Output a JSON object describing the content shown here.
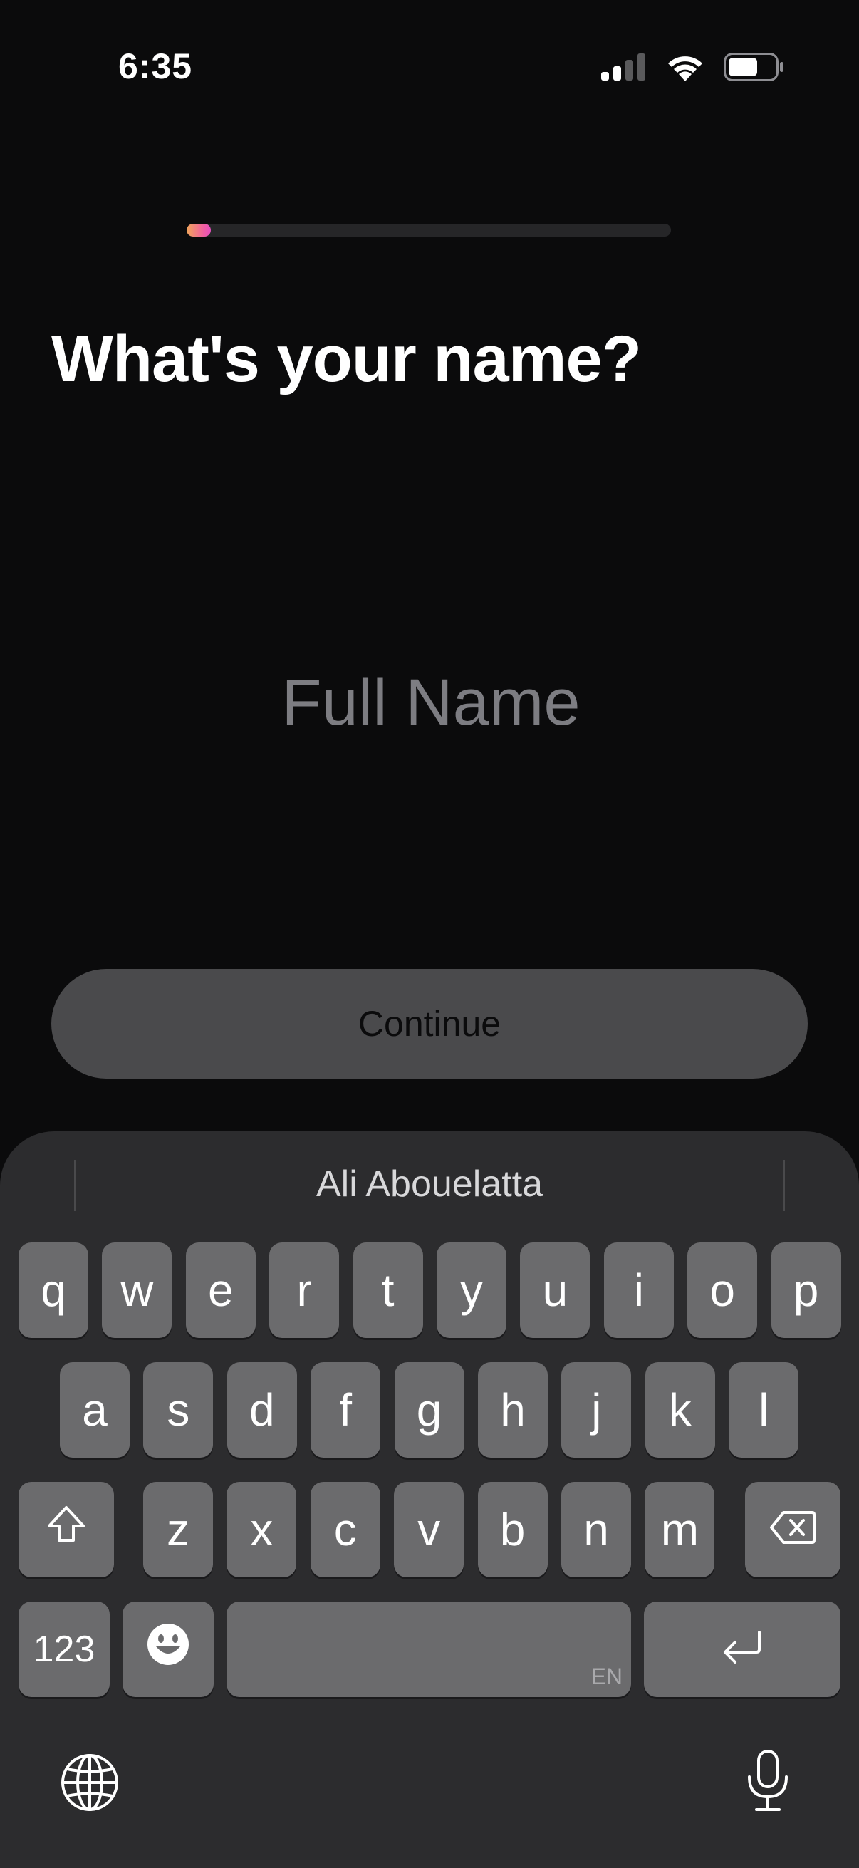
{
  "status_bar": {
    "time": "6:35"
  },
  "progress": {
    "fraction": 0.05,
    "colors": [
      "#f0a55a",
      "#f05fa0"
    ]
  },
  "question": {
    "title": "What's your name?"
  },
  "name_field": {
    "value": "",
    "placeholder": "Full Name"
  },
  "continue_button": {
    "label": "Continue"
  },
  "keyboard": {
    "suggestion": "Ali Abouelatta",
    "row1": [
      "q",
      "w",
      "e",
      "r",
      "t",
      "y",
      "u",
      "i",
      "o",
      "p"
    ],
    "row2": [
      "a",
      "s",
      "d",
      "f",
      "g",
      "h",
      "j",
      "k",
      "l"
    ],
    "row3": [
      "z",
      "x",
      "c",
      "v",
      "b",
      "n",
      "m"
    ],
    "numbers_label": "123",
    "language_label": "EN"
  },
  "icons": {
    "signal": "cellular-signal-icon",
    "wifi": "wifi-icon",
    "battery": "battery-icon",
    "shift": "shift-icon",
    "delete": "delete-icon",
    "emoji": "emoji-icon",
    "return": "return-icon",
    "globe": "globe-icon",
    "mic": "microphone-icon"
  }
}
